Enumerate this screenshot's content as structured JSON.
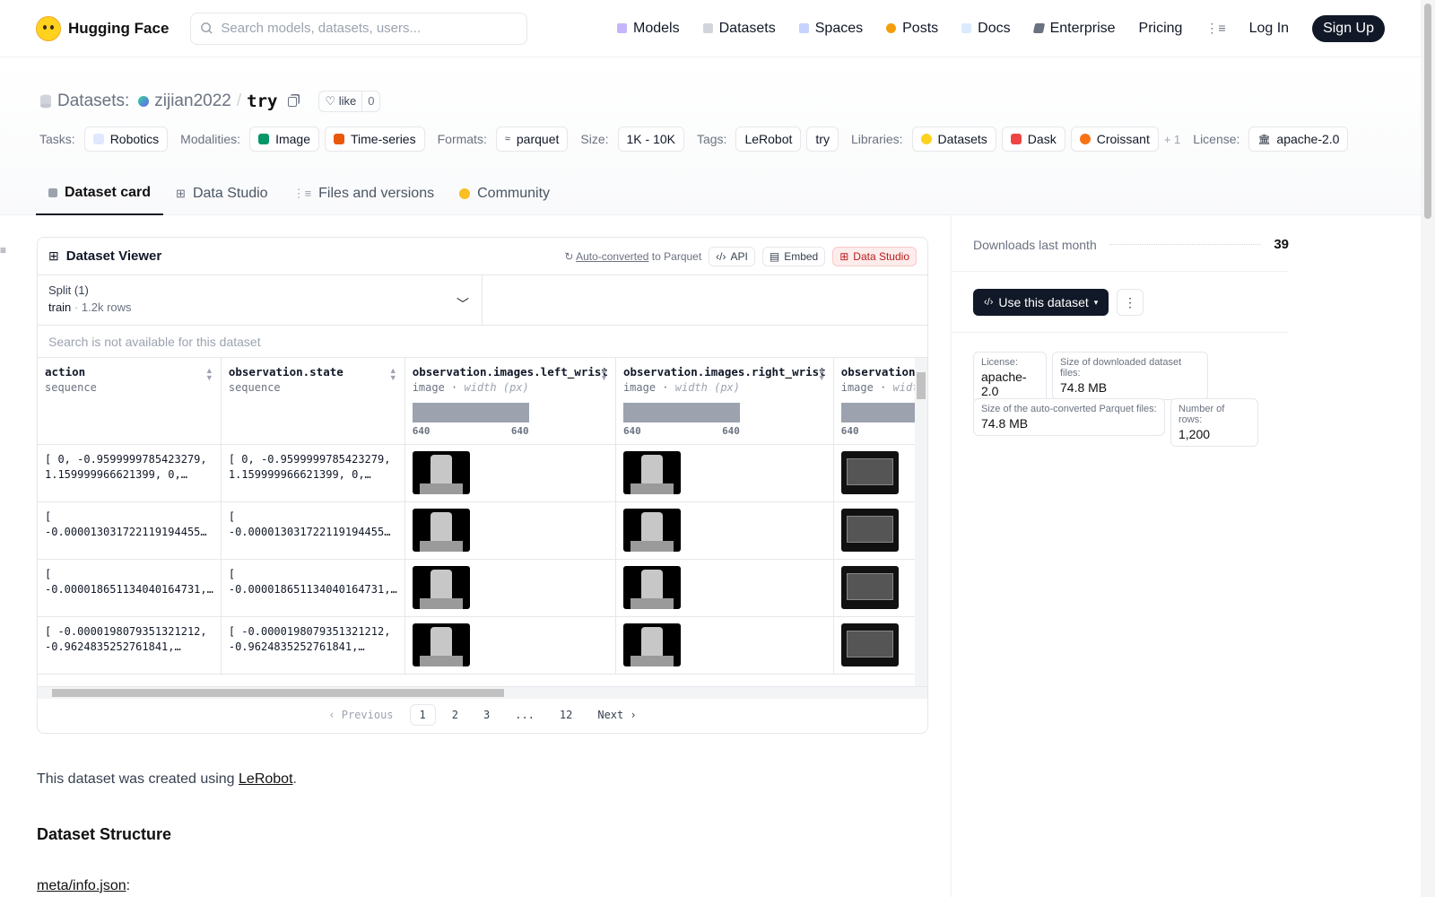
{
  "nav": {
    "brand": "Hugging Face",
    "search_placeholder": "Search models, datasets, users...",
    "links": [
      "Models",
      "Datasets",
      "Spaces",
      "Posts",
      "Docs",
      "Enterprise",
      "Pricing"
    ],
    "login": "Log In",
    "signup": "Sign Up"
  },
  "repo": {
    "section": "Datasets:",
    "owner": "zijian2022",
    "sep": "/",
    "name": "try",
    "like_label": "like",
    "like_count": "0"
  },
  "meta": {
    "tasks_label": "Tasks:",
    "task": "Robotics",
    "modalities_label": "Modalities:",
    "modality_1": "Image",
    "modality_2": "Time-series",
    "formats_label": "Formats:",
    "format": "parquet",
    "size_label": "Size:",
    "size": "1K - 10K",
    "tags_label": "Tags:",
    "tag_1": "LeRobot",
    "tag_2": "try",
    "libraries_label": "Libraries:",
    "lib_1": "Datasets",
    "lib_2": "Dask",
    "lib_3": "Croissant",
    "more_libs": "+ 1",
    "license_label": "License:",
    "license": "apache-2.0"
  },
  "tabs": [
    "Dataset card",
    "Data Studio",
    "Files and versions",
    "Community"
  ],
  "viewer": {
    "title": "Dataset Viewer",
    "auto_converted": "Auto-converted",
    "to_parquet": "to Parquet",
    "api": "API",
    "embed": "Embed",
    "data_studio": "Data Studio",
    "split_label": "Split (1)",
    "split_name": "train",
    "split_rows": "1.2k rows",
    "search_na": "Search is not available for this dataset",
    "columns": [
      {
        "name": "action",
        "type": "sequence"
      },
      {
        "name": "observation.state",
        "type": "sequence"
      },
      {
        "name": "observation.images.left_wrist",
        "type": "image",
        "sub": "width (px)",
        "min": "640",
        "max": "640"
      },
      {
        "name": "observation.images.right_wrist",
        "type": "image",
        "sub": "width (px)",
        "min": "640",
        "max": "640"
      },
      {
        "name": "observation.i",
        "type": "image",
        "sub": "width",
        "min": "640"
      }
    ],
    "rows": [
      {
        "action": "[ 0, -0.9599999785423279, 1.159999966621399, 0,…",
        "state": "[ 0, -0.9599999785423279, 1.159999966621399, 0,…"
      },
      {
        "action": "[ -0.000013031722119194455…",
        "state": "[ -0.000013031722119194455…"
      },
      {
        "action": "[ -0.000018651134040164731,…",
        "state": "[ -0.000018651134040164731,…"
      },
      {
        "action": "[ -0.000019807935132121​2, -0.9624835252761841,…",
        "state": "[ -0.000019807935132121​2, -0.9624835252761841,…"
      }
    ],
    "pager": {
      "prev": "Previous",
      "pages": [
        "1",
        "2",
        "3",
        "...",
        "12"
      ],
      "next": "Next"
    }
  },
  "card": {
    "intro_pre": "This dataset was created using ",
    "intro_link": "LeRobot",
    "intro_post": ".",
    "h_structure": "Dataset Structure",
    "meta_link": "meta/info.json",
    "meta_colon": ":"
  },
  "side": {
    "downloads_label": "Downloads last month",
    "downloads": "39",
    "use_btn": "Use this dataset",
    "license_k": "License:",
    "license_v": "apache-2.0",
    "dl_size_k": "Size of downloaded dataset files:",
    "dl_size_v": "74.8 MB",
    "pq_size_k": "Size of the auto-converted Parquet files:",
    "pq_size_v": "74.8 MB",
    "rows_k": "Number of rows:",
    "rows_v": "1,200"
  }
}
